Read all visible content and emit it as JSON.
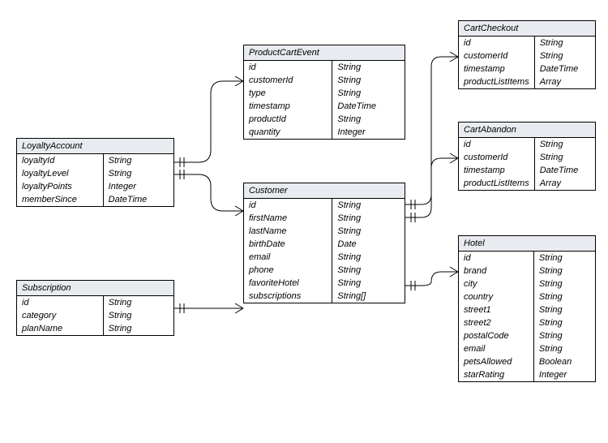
{
  "entities": {
    "loyalty": {
      "title": "LoyaltyAccount",
      "rows": [
        {
          "attr": "loyaltyId",
          "type": "String"
        },
        {
          "attr": "loyaltyLevel",
          "type": "String"
        },
        {
          "attr": "loyaltyPoints",
          "type": "Integer"
        },
        {
          "attr": "memberSince",
          "type": "DateTime"
        }
      ]
    },
    "subscription": {
      "title": "Subscription",
      "rows": [
        {
          "attr": "id",
          "type": "String"
        },
        {
          "attr": "category",
          "type": "String"
        },
        {
          "attr": "planName",
          "type": "String"
        }
      ]
    },
    "productcart": {
      "title": "ProductCartEvent",
      "rows": [
        {
          "attr": "id",
          "type": "String"
        },
        {
          "attr": "customerId",
          "type": "String"
        },
        {
          "attr": "type",
          "type": "String"
        },
        {
          "attr": "timestamp",
          "type": "DateTime"
        },
        {
          "attr": "productId",
          "type": "String"
        },
        {
          "attr": "quantity",
          "type": "Integer"
        }
      ]
    },
    "customer": {
      "title": "Customer",
      "rows": [
        {
          "attr": "id",
          "type": "String"
        },
        {
          "attr": "firstName",
          "type": "String"
        },
        {
          "attr": "lastName",
          "type": "String"
        },
        {
          "attr": "birthDate",
          "type": "Date"
        },
        {
          "attr": "email",
          "type": "String"
        },
        {
          "attr": "phone",
          "type": "String"
        },
        {
          "attr": "favoriteHotel",
          "type": "String"
        },
        {
          "attr": "subscriptions",
          "type": "String[]"
        }
      ]
    },
    "checkout": {
      "title": "CartCheckout",
      "rows": [
        {
          "attr": "id",
          "type": "String"
        },
        {
          "attr": "customerId",
          "type": "String"
        },
        {
          "attr": "timestamp",
          "type": "DateTime"
        },
        {
          "attr": "productListItems",
          "type": "Array"
        }
      ]
    },
    "abandon": {
      "title": "CartAbandon",
      "rows": [
        {
          "attr": "id",
          "type": "String"
        },
        {
          "attr": "customerId",
          "type": "String"
        },
        {
          "attr": "timestamp",
          "type": "DateTime"
        },
        {
          "attr": "productListItems",
          "type": "Array"
        }
      ]
    },
    "hotel": {
      "title": "Hotel",
      "rows": [
        {
          "attr": "id",
          "type": "String"
        },
        {
          "attr": "brand",
          "type": "String"
        },
        {
          "attr": "city",
          "type": "String"
        },
        {
          "attr": "country",
          "type": "String"
        },
        {
          "attr": "street1",
          "type": "String"
        },
        {
          "attr": "street2",
          "type": "String"
        },
        {
          "attr": "postalCode",
          "type": "String"
        },
        {
          "attr": "email",
          "type": "String"
        },
        {
          "attr": "petsAllowed",
          "type": "Boolean"
        },
        {
          "attr": "starRating",
          "type": "Integer"
        }
      ]
    }
  },
  "chart_data": {
    "type": "table",
    "title": "Entity-Relationship Diagram",
    "entities": [
      "LoyaltyAccount",
      "Subscription",
      "ProductCartEvent",
      "Customer",
      "CartCheckout",
      "CartAbandon",
      "Hotel"
    ],
    "relationships": [
      {
        "from": "LoyaltyAccount",
        "fromCard": "one",
        "to": "ProductCartEvent",
        "toCard": "many"
      },
      {
        "from": "LoyaltyAccount",
        "fromCard": "one",
        "to": "Customer",
        "toCard": "many"
      },
      {
        "from": "Subscription",
        "fromCard": "one",
        "to": "Customer",
        "toCard": "many"
      },
      {
        "from": "Customer",
        "fromCard": "one",
        "to": "CartCheckout",
        "toCard": "many"
      },
      {
        "from": "Customer",
        "fromCard": "one",
        "to": "CartAbandon",
        "toCard": "many"
      },
      {
        "from": "Customer",
        "fromCard": "one",
        "to": "Hotel",
        "toCard": "many"
      }
    ]
  }
}
